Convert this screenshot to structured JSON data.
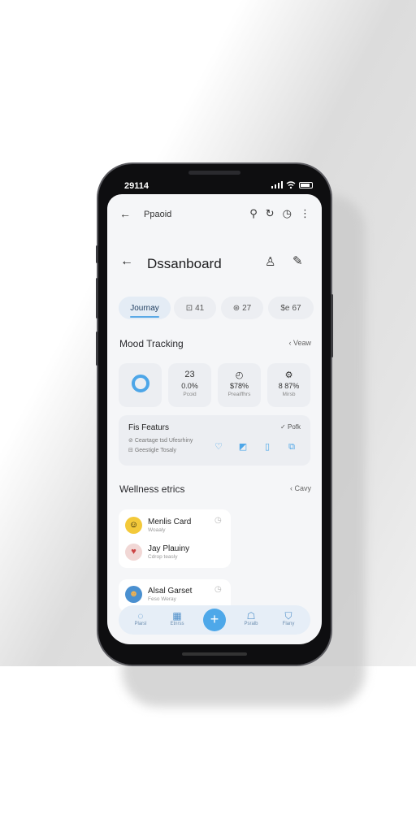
{
  "status_bar": {
    "time": "29114"
  },
  "app_bar": {
    "title": "Ppaoid"
  },
  "header": {
    "title": "Dssanboard"
  },
  "tabs": [
    {
      "label": "Journay",
      "icon": ""
    },
    {
      "label": "41",
      "icon": "calendar-icon"
    },
    {
      "label": "27",
      "icon": "target-icon"
    },
    {
      "label": "67",
      "icon": "chart-icon"
    }
  ],
  "mood_tracking": {
    "label": "Mood Tracking",
    "action": "Veaw",
    "stats": [
      {
        "value": "",
        "caption": ""
      },
      {
        "icon": "23",
        "value": "0.0%",
        "caption": "Pcoid"
      },
      {
        "value": "$78%",
        "caption": "Preaiffhrs"
      },
      {
        "value": "8 87%",
        "caption": "Mirsb"
      }
    ]
  },
  "features": {
    "title": "Fis Featurs",
    "action": "Pofk",
    "rows": [
      "Ceartage tsd Ufesrhiny",
      "Geestigle Tosaly"
    ]
  },
  "wellness": {
    "label": "Wellness etrics",
    "action": "Cavy",
    "people": [
      {
        "name": "Menlis Card",
        "sub": "Woaaly"
      },
      {
        "name": "Jay Plauiny",
        "sub": "Cdrop teasly"
      },
      {
        "name": "Alsal Garset",
        "sub": "Feso Weray"
      }
    ]
  },
  "bottom_nav": [
    {
      "label": "Plarsl"
    },
    {
      "label": "Etnrss"
    },
    {
      "label": "Psralb"
    },
    {
      "label": "Flany"
    }
  ]
}
